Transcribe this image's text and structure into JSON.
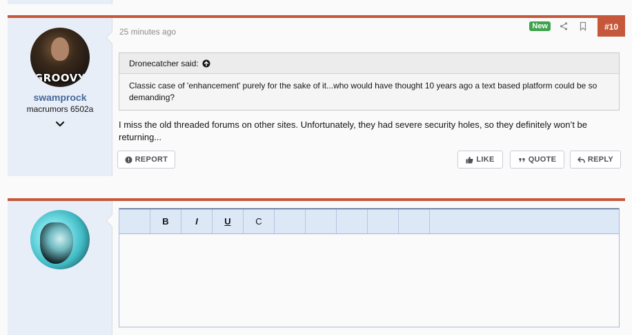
{
  "post1": {
    "timestamp": "25 minutes ago",
    "badge_new": "New",
    "post_number": "#10",
    "author": {
      "username": "swamprock",
      "user_title": "macrumors 6502a",
      "avatar_text": "GROOVY"
    },
    "quote": {
      "attribution": "Dronecatcher said:",
      "text": "Classic case of 'enhancement' purely for the sake of it...who would have thought 10 years ago a text based platform could be so demanding?"
    },
    "message": "I miss the old threaded forums on other sites. Unfortunately, they had severe security holes, so they definitely won’t be returning...",
    "buttons": {
      "report": "REPORT",
      "like": "LIKE",
      "quote": "QUOTE",
      "reply": "REPLY"
    }
  },
  "editor": {
    "toolbar": [
      "",
      "B",
      "I",
      "U",
      "C",
      "",
      "",
      "",
      "",
      ""
    ]
  },
  "colors": {
    "accent_bar": "#c5573a",
    "username": "#47699b",
    "new_badge": "#3fa34d",
    "sidebar_bg": "#e8eef8"
  }
}
